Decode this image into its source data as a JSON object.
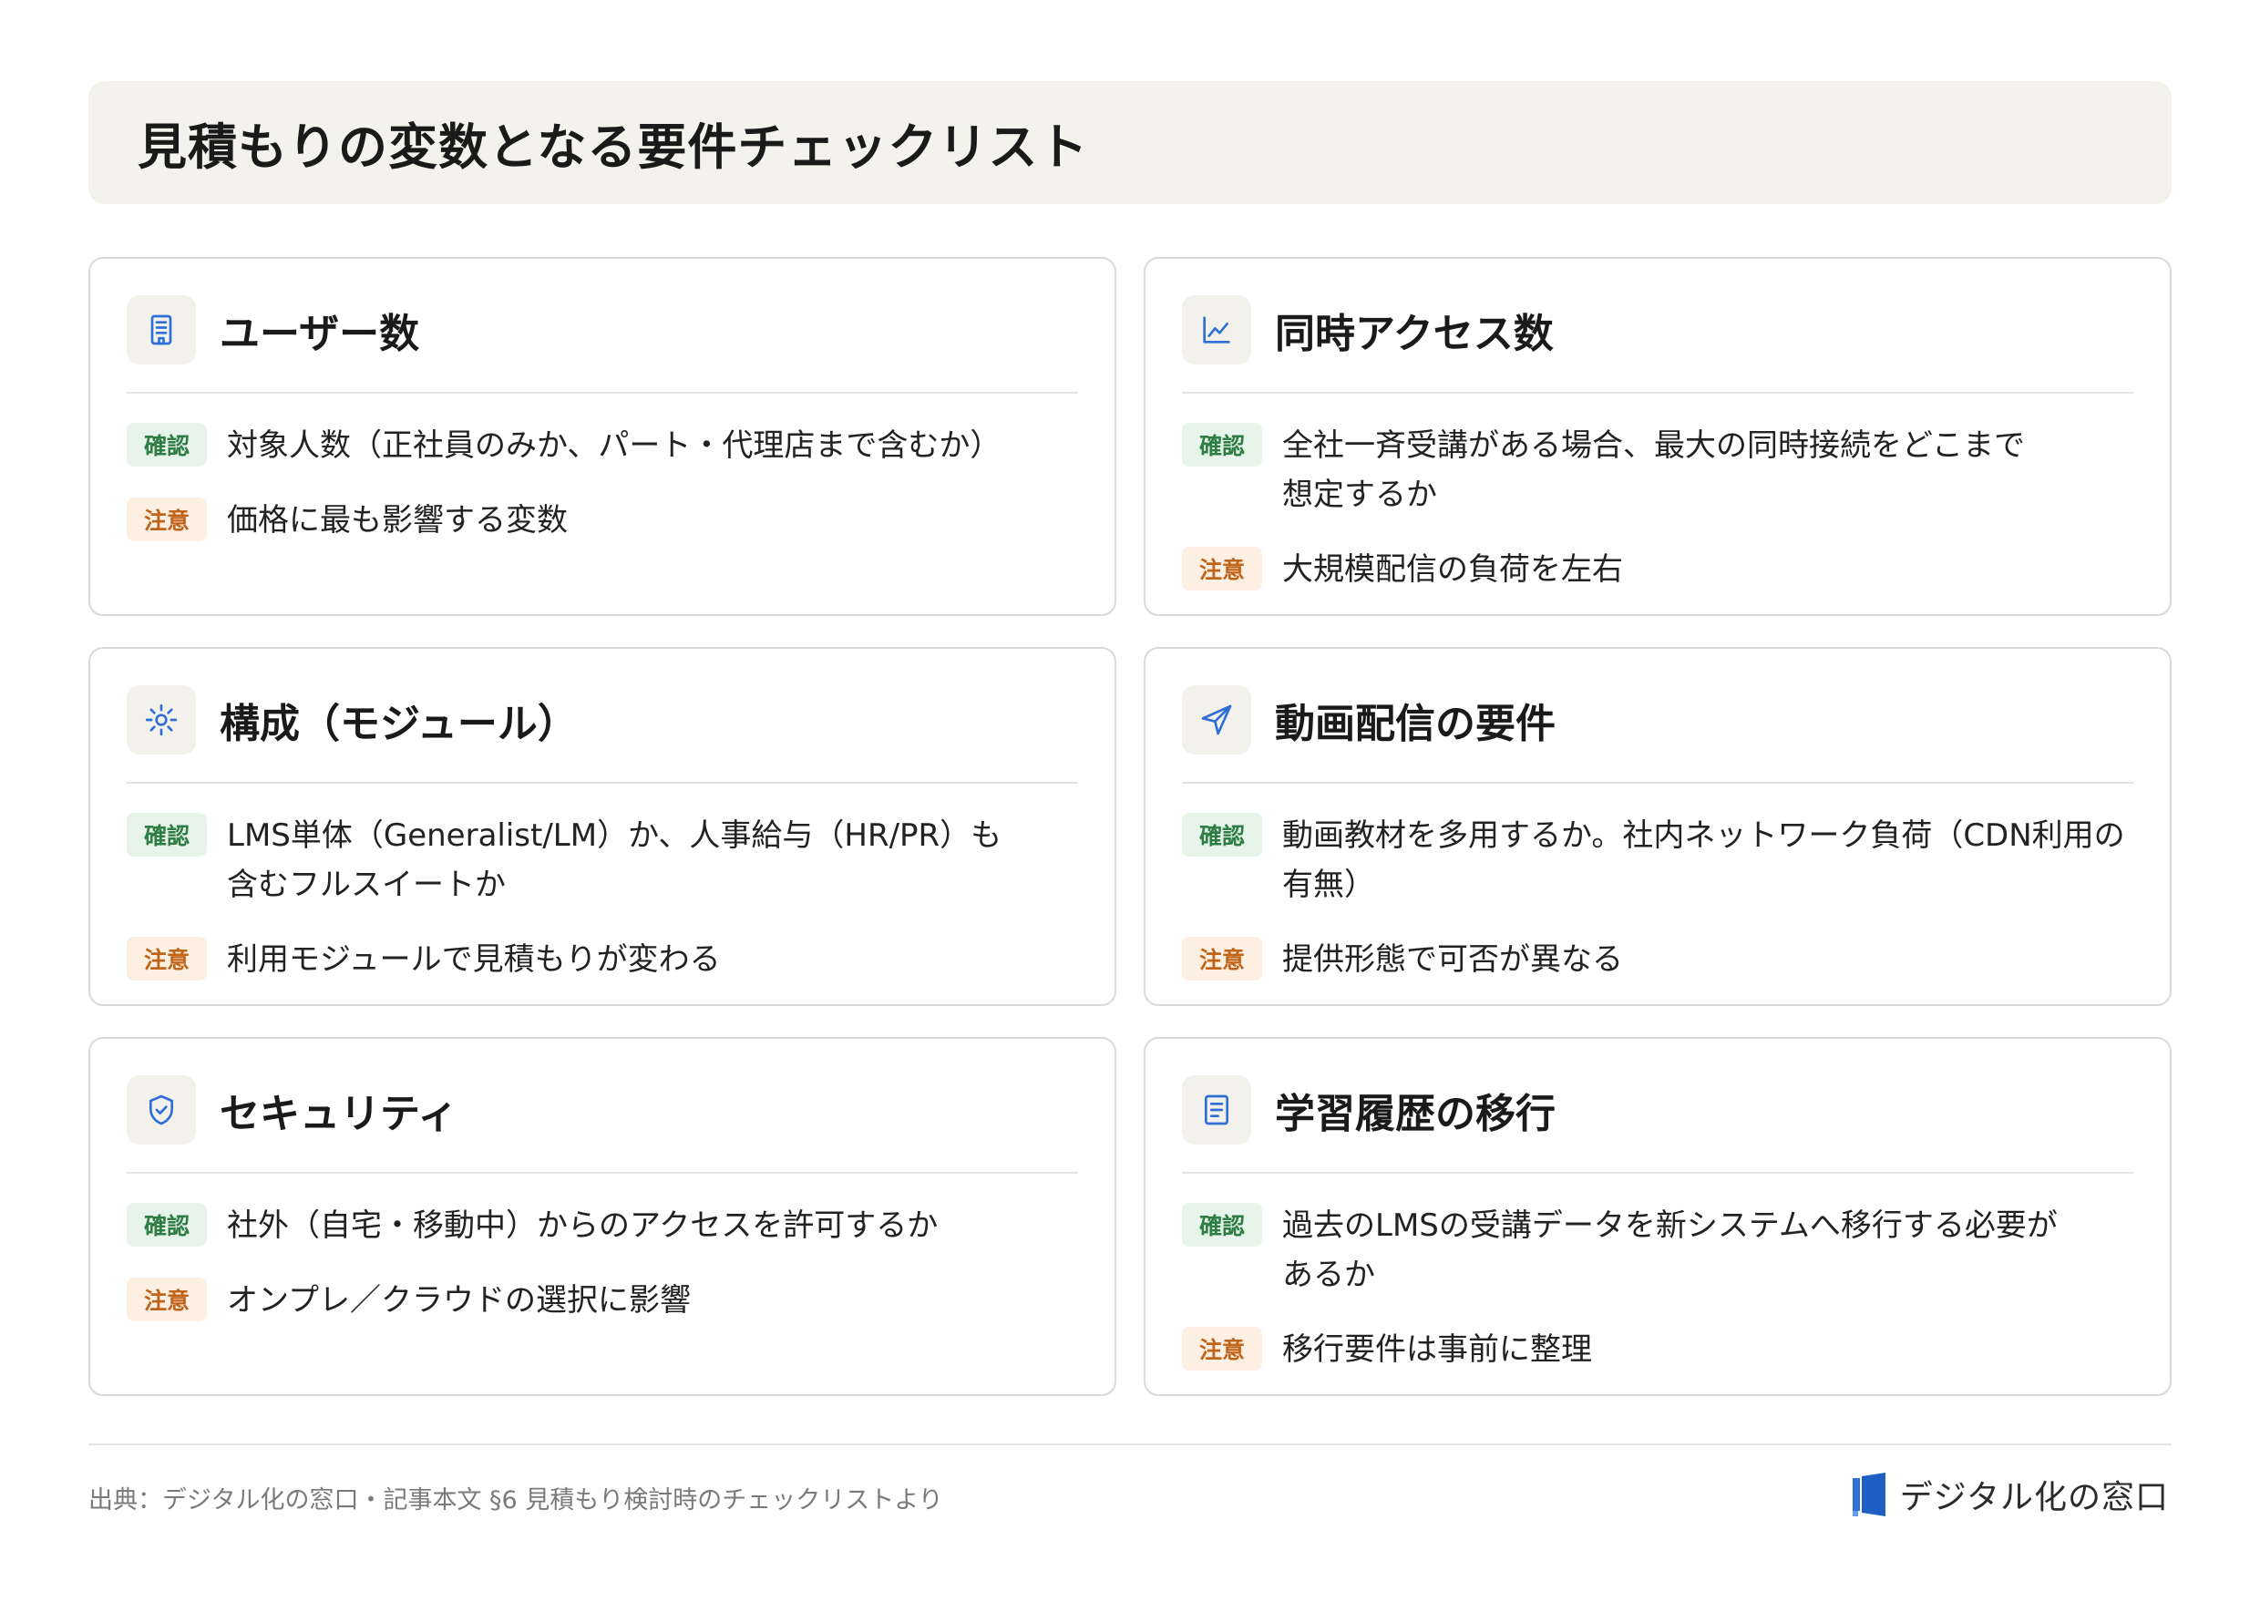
{
  "header": {
    "title": "見積もりの変数となる要件チェックリスト"
  },
  "badges": {
    "confirm": "確認",
    "caution": "注意"
  },
  "cards": [
    {
      "icon": "building-icon",
      "title": "ユーザー数",
      "confirm": "対象人数（正社員のみか、パート・代理店まで含むか）",
      "caution": "価格に最も影響する変数"
    },
    {
      "icon": "line-chart-icon",
      "title": "同時アクセス数",
      "confirm": "全社一斉受講がある場合、最大の同時接続をどこまで想定するか",
      "caution": "大規模配信の負荷を左右"
    },
    {
      "icon": "gear-icon",
      "title": "構成（モジュール）",
      "confirm": "LMS単体（Generalist/LM）か、人事給与（HR/PR）も含むフルスイートか",
      "caution": "利用モジュールで見積もりが変わる"
    },
    {
      "icon": "send-icon",
      "title": "動画配信の要件",
      "confirm": "動画教材を多用するか。社内ネットワーク負荷（CDN利用の有無）",
      "caution": "提供形態で可否が異なる"
    },
    {
      "icon": "shield-check-icon",
      "title": "セキュリティ",
      "confirm": "社外（自宅・移動中）からのアクセスを許可するか",
      "caution": "オンプレ／クラウドの選択に影響"
    },
    {
      "icon": "document-icon",
      "title": "学習履歴の移行",
      "confirm": "過去のLMSの受講データを新システムへ移行する必要があるか",
      "caution": "移行要件は事前に整理"
    }
  ],
  "footer": {
    "source": "出典：デジタル化の窓口・記事本文 §6 見積もり検討時のチェックリストより",
    "brand": "デジタル化の窓口"
  },
  "colors": {
    "accent": "#2f6fd6",
    "confirm_bg": "#e7f4ea",
    "confirm_text": "#2e7d45",
    "caution_bg": "#fdf0e2",
    "caution_text": "#c0641a"
  }
}
